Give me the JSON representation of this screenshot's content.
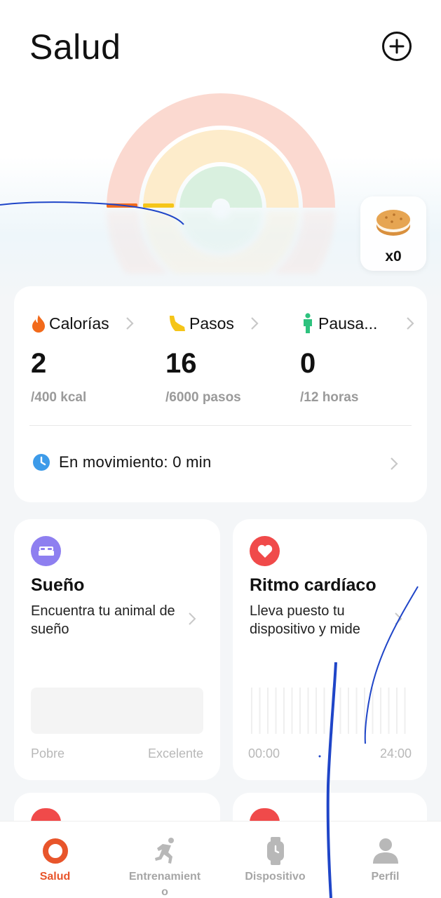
{
  "header": {
    "title": "Salud",
    "add_icon": "plus-circle-icon"
  },
  "cookie_badge": {
    "icon": "cookie-icon",
    "count": "x0"
  },
  "activity": {
    "calories": {
      "label": "Calorías",
      "value": "2",
      "goal": "/400 kcal",
      "icon": "flame-icon",
      "color": "#f26a1b"
    },
    "steps": {
      "label": "Pasos",
      "value": "16",
      "goal": "/6000 pasos",
      "icon": "shoe-icon",
      "color": "#f5c518"
    },
    "standing": {
      "label": "Pausa...",
      "value": "0",
      "goal": "/12 horas",
      "icon": "person-standing-icon",
      "color": "#2ec27e"
    },
    "moving": {
      "label": "En movimiento: 0 min",
      "icon": "clock-icon",
      "color": "#3d9be9"
    }
  },
  "sleep_card": {
    "title": "Sueño",
    "subtitle": "Encuentra tu animal de sueño",
    "icon": "bed-icon",
    "icon_bg": "#8e7ff0",
    "range_low": "Pobre",
    "range_high": "Excelente"
  },
  "heart_card": {
    "title": "Ritmo cardíaco",
    "subtitle": "Lleva puesto tu dispositivo y mide",
    "icon": "heart-icon",
    "icon_bg": "#f04a4a",
    "time_start": "00:00",
    "time_end": "24:00"
  },
  "tabs": [
    {
      "label": "Salud",
      "icon": "health-ring-icon",
      "active": true
    },
    {
      "label": "Entrenamiento",
      "icon": "running-icon",
      "active": false
    },
    {
      "label": "Dispositivo",
      "icon": "watch-icon",
      "active": false
    },
    {
      "label": "Perfil",
      "icon": "profile-icon",
      "active": false
    }
  ],
  "colors": {
    "accent": "#e8552b",
    "ring_outer": "#fbd9d0",
    "ring_middle": "#fdeccb",
    "ring_inner": "#d9f0df"
  }
}
